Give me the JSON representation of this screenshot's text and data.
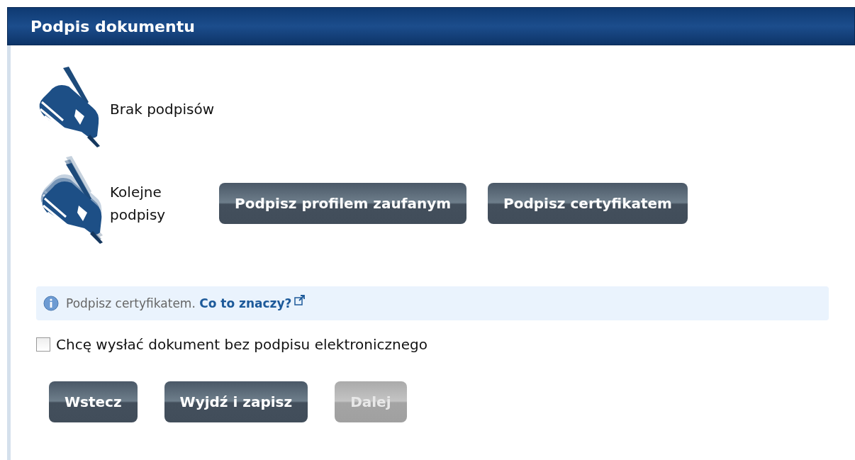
{
  "header": {
    "title": "Podpis dokumentu"
  },
  "signatures": [
    {
      "kind": "single",
      "label": "Brak podpisów"
    },
    {
      "kind": "multiple",
      "label": "Kolejne podpisy",
      "buttons": [
        "Podpisz profilem zaufanym",
        "Podpisz certyfikatem"
      ]
    }
  ],
  "info": {
    "text": "Podpisz certyfikatem.",
    "link": "Co to znaczy?"
  },
  "checkbox": {
    "label": "Chcę wysłać dokument bez podpisu elektronicznego",
    "checked": false
  },
  "nav_buttons": [
    {
      "label": "Wstecz",
      "disabled": false
    },
    {
      "label": "Wyjdź i zapisz",
      "disabled": false
    },
    {
      "label": "Dalej",
      "disabled": true
    }
  ]
}
